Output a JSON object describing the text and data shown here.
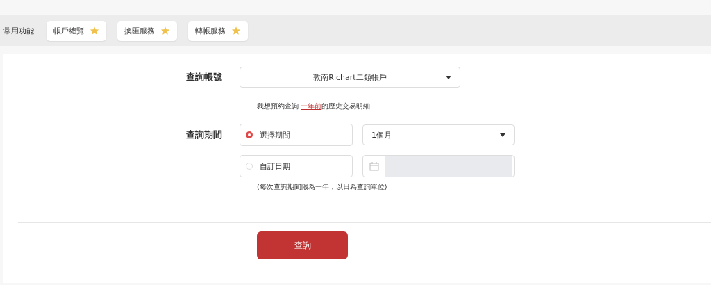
{
  "quick_bar": {
    "label": "常用功能",
    "items": [
      {
        "label": "帳戶總覽",
        "starred": true
      },
      {
        "label": "換匯服務",
        "starred": true
      },
      {
        "label": "轉帳服務",
        "starred": true
      }
    ]
  },
  "account": {
    "label": "查詢帳號",
    "value": "敦南Richart二類帳戶"
  },
  "history_note": {
    "before": "我想預約查詢 ",
    "link": "一年前",
    "after": "的歷史交易明細"
  },
  "period": {
    "label": "查詢期間",
    "options": [
      {
        "label": "選擇期間",
        "selected": true,
        "kind": "select",
        "value": "1個月"
      },
      {
        "label": "自訂日期",
        "selected": false,
        "kind": "date",
        "disabled": true
      }
    ]
  },
  "period_note": "(每次查詢期間限為一年，以日為查詢單位)",
  "submit": "查詢"
}
